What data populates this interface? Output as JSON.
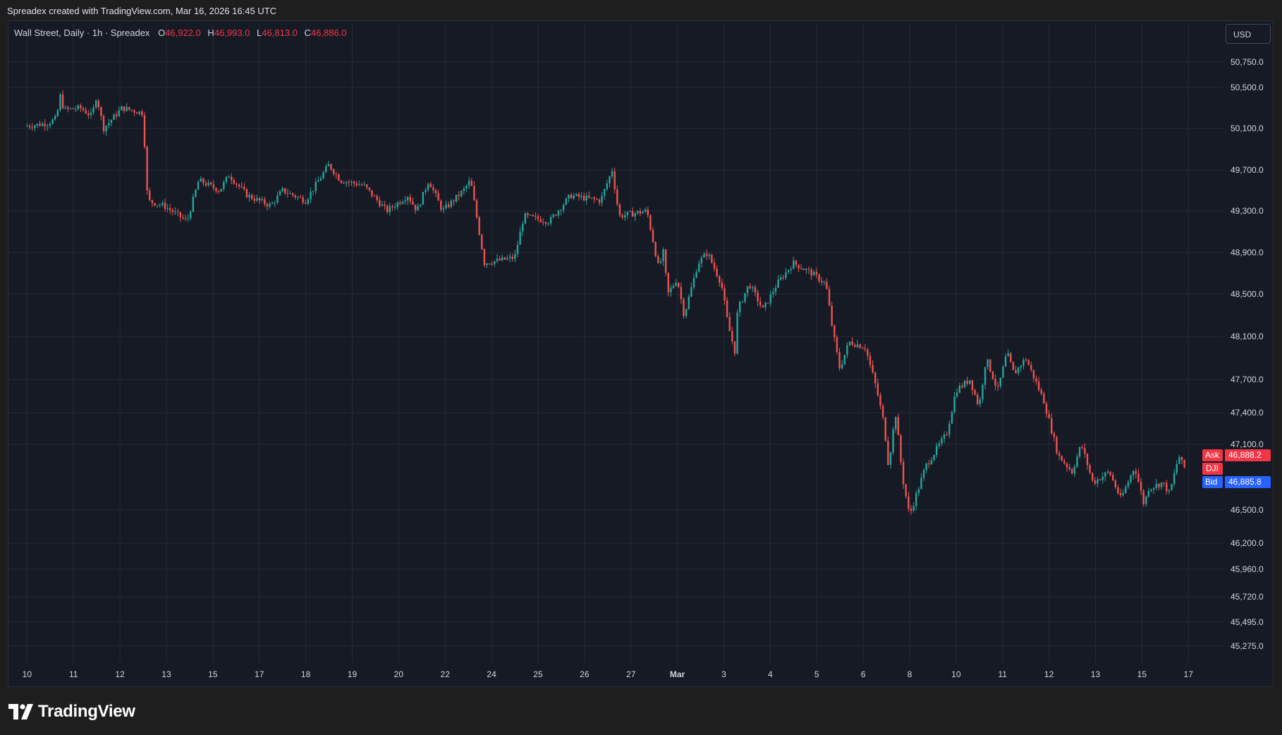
{
  "caption": "Spreadex created with TradingView.com, Mar 16, 2026 16:45 UTC",
  "legend": {
    "symbol": "Wall Street, Daily · 1h · Spreadex",
    "o_label": "O",
    "o_value": "46,922.0",
    "h_label": "H",
    "h_value": "46,993.0",
    "l_label": "L",
    "l_value": "46,813.0",
    "c_label": "C",
    "c_value": "46,886.0"
  },
  "currency": "USD",
  "tags": {
    "ask_label": "Ask",
    "ask_value": "46,888.2",
    "symbol_label": "DJI",
    "bid_label": "Bid",
    "bid_value": "46,885.8"
  },
  "brand": "TradingView",
  "colors": {
    "up": "#26a69a",
    "down": "#ef5350",
    "ask": "#f23645",
    "bid": "#2962ff",
    "background": "#161a25",
    "grid": "#252a36",
    "text": "#d1d4dc"
  },
  "chart_data": {
    "type": "candlestick",
    "interval": "1h",
    "y_tick_labels": [
      "50,750.0",
      "50,500.0",
      "50,100.0",
      "49,700.0",
      "49,300.0",
      "48,900.0",
      "48,500.0",
      "48,100.0",
      "47,700.0",
      "47,400.0",
      "47,100.0",
      "46,500.0",
      "46,200.0",
      "45,960.0",
      "45,720.0",
      "45,495.0",
      "45,275.0"
    ],
    "y_tick_values": [
      50750,
      50500,
      50100,
      49700,
      49300,
      48900,
      48500,
      48100,
      47700,
      47400,
      47100,
      46500,
      46200,
      45960,
      45720,
      45495,
      45275
    ],
    "x_tick_labels": [
      "10",
      "11",
      "12",
      "13",
      "15",
      "17",
      "18",
      "19",
      "20",
      "22",
      "24",
      "25",
      "26",
      "27",
      "Mar",
      "3",
      "4",
      "5",
      "6",
      "8",
      "10",
      "11",
      "12",
      "13",
      "15",
      "17"
    ],
    "x_tick_pos": [
      0,
      1,
      2,
      3,
      4,
      5,
      6,
      7,
      8,
      9,
      10,
      11,
      12,
      13,
      14,
      15,
      16,
      17,
      18,
      19,
      20,
      21,
      22,
      23,
      24,
      25
    ],
    "x_range": [
      -0.4,
      25.3
    ],
    "price_path": [
      [
        0,
        50120
      ],
      [
        0.5,
        50150
      ],
      [
        0.7,
        50200
      ],
      [
        0.75,
        50450
      ],
      [
        0.85,
        50280
      ],
      [
        1.2,
        50300
      ],
      [
        1.45,
        50220
      ],
      [
        1.55,
        50420
      ],
      [
        1.7,
        50100
      ],
      [
        2.1,
        50300
      ],
      [
        2.55,
        50250
      ],
      [
        2.65,
        49400
      ],
      [
        3.0,
        49350
      ],
      [
        3.5,
        49200
      ],
      [
        3.75,
        49600
      ],
      [
        4.2,
        49500
      ],
      [
        4.4,
        49650
      ],
      [
        4.8,
        49450
      ],
      [
        5.3,
        49350
      ],
      [
        5.55,
        49500
      ],
      [
        6.05,
        49400
      ],
      [
        6.55,
        49750
      ],
      [
        6.8,
        49600
      ],
      [
        7.3,
        49550
      ],
      [
        7.8,
        49300
      ],
      [
        8.25,
        49450
      ],
      [
        8.45,
        49300
      ],
      [
        8.7,
        49600
      ],
      [
        9.0,
        49300
      ],
      [
        9.45,
        49500
      ],
      [
        9.6,
        49600
      ],
      [
        9.9,
        48800
      ],
      [
        10.55,
        48850
      ],
      [
        10.75,
        49250
      ],
      [
        11.3,
        49200
      ],
      [
        11.75,
        49450
      ],
      [
        12.4,
        49400
      ],
      [
        12.65,
        49700
      ],
      [
        12.8,
        49250
      ],
      [
        13.4,
        49300
      ],
      [
        13.65,
        48750
      ],
      [
        13.75,
        48900
      ],
      [
        13.85,
        48500
      ],
      [
        14.05,
        48650
      ],
      [
        14.2,
        48300
      ],
      [
        14.5,
        48800
      ],
      [
        14.7,
        48900
      ],
      [
        15.0,
        48600
      ],
      [
        15.15,
        48200
      ],
      [
        15.3,
        47950
      ],
      [
        15.35,
        48350
      ],
      [
        15.6,
        48600
      ],
      [
        15.9,
        48350
      ],
      [
        16.2,
        48600
      ],
      [
        16.55,
        48800
      ],
      [
        16.95,
        48700
      ],
      [
        17.25,
        48600
      ],
      [
        17.4,
        48150
      ],
      [
        17.55,
        47800
      ],
      [
        17.75,
        48050
      ],
      [
        18.1,
        48000
      ],
      [
        18.35,
        47600
      ],
      [
        18.5,
        47300
      ],
      [
        18.6,
        46900
      ],
      [
        18.75,
        47400
      ],
      [
        18.9,
        46800
      ],
      [
        19.05,
        46450
      ],
      [
        19.4,
        46900
      ],
      [
        19.85,
        47200
      ],
      [
        20.05,
        47600
      ],
      [
        20.35,
        47700
      ],
      [
        20.55,
        47450
      ],
      [
        20.7,
        47900
      ],
      [
        20.95,
        47600
      ],
      [
        21.15,
        47950
      ],
      [
        21.3,
        47750
      ],
      [
        21.55,
        47900
      ],
      [
        21.95,
        47500
      ],
      [
        22.25,
        47000
      ],
      [
        22.55,
        46850
      ],
      [
        22.75,
        47100
      ],
      [
        23.0,
        46750
      ],
      [
        23.35,
        46850
      ],
      [
        23.6,
        46600
      ],
      [
        23.9,
        46900
      ],
      [
        24.1,
        46550
      ],
      [
        24.2,
        46700
      ],
      [
        24.5,
        46750
      ],
      [
        24.65,
        46650
      ],
      [
        24.85,
        47000
      ],
      [
        24.95,
        46888
      ]
    ]
  }
}
